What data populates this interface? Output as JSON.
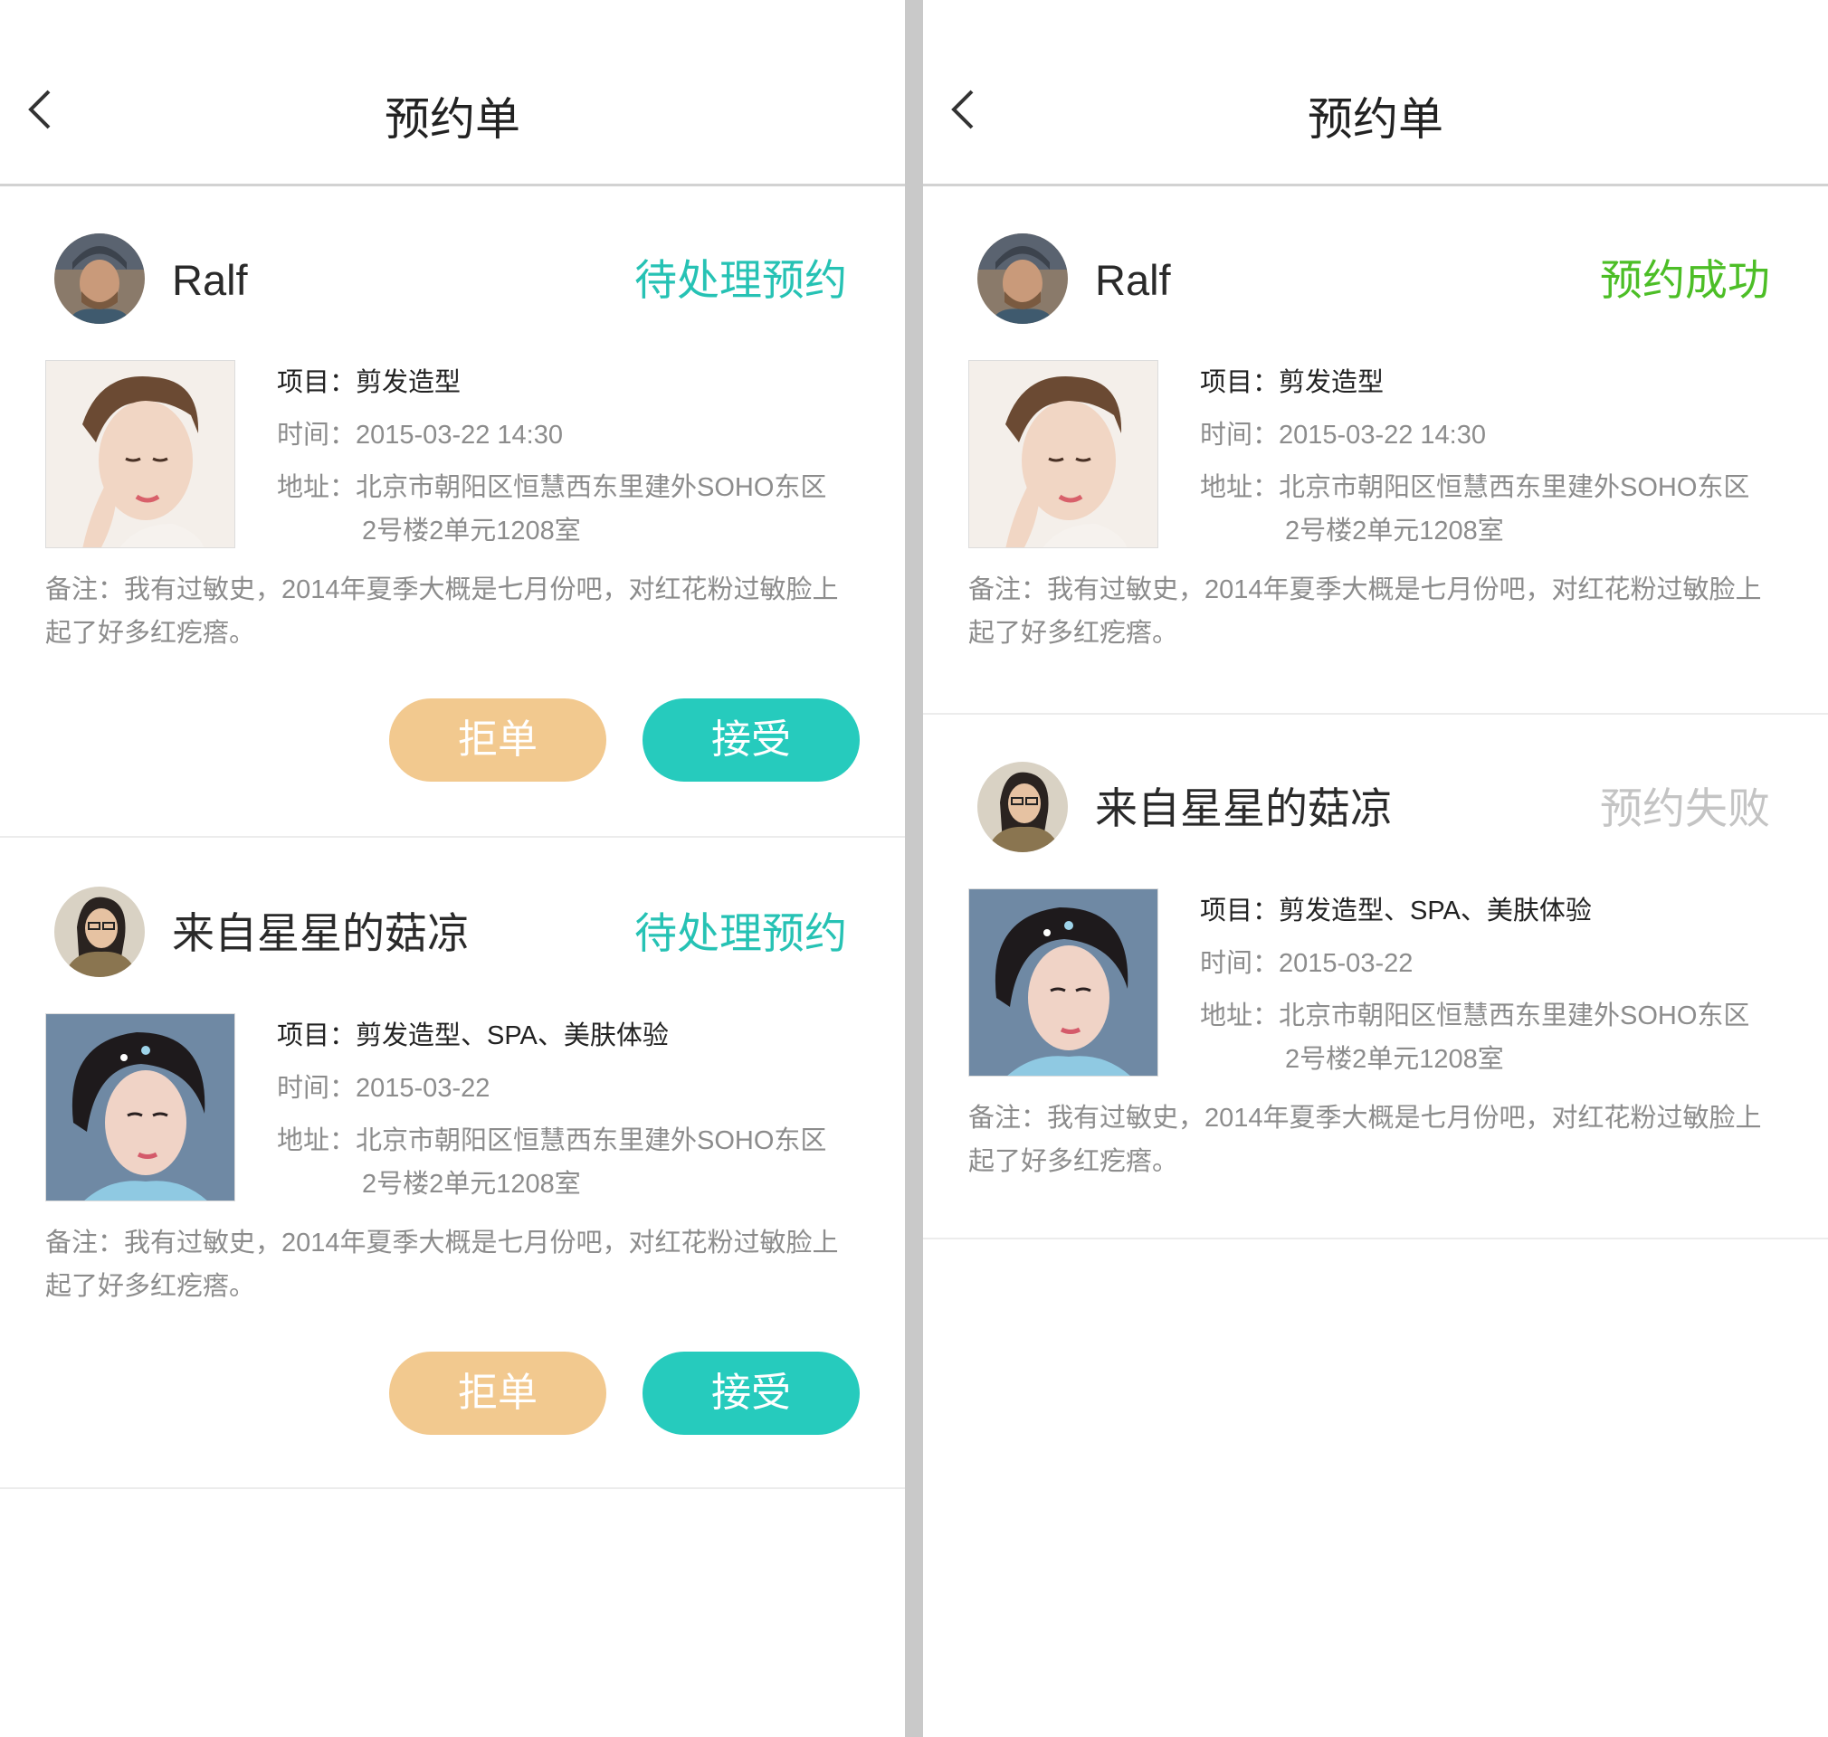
{
  "left": {
    "title": "预约单",
    "orders": [
      {
        "name": "Ralf",
        "status": "待处理预约",
        "project_label": "项目：",
        "project": "剪发造型",
        "time_label": "时间：",
        "time": "2015-03-22  14:30",
        "addr_label": "地址：",
        "address_line1": "北京市朝阳区恒慧西东里建外SOHO东区",
        "address_line2": "2号楼2单元1208室",
        "note_label": "备注：",
        "note": "我有过敏史，2014年夏季大概是七月份吧，对红花粉过敏脸上起了好多红疙瘩。",
        "reject_label": "拒单",
        "accept_label": "接受"
      },
      {
        "name": "来自星星的菇凉",
        "status": "待处理预约",
        "project_label": "项目：",
        "project": "剪发造型、SPA、美肤体验",
        "time_label": "时间：",
        "time": "2015-03-22",
        "addr_label": "地址：",
        "address_line1": "北京市朝阳区恒慧西东里建外SOHO东区",
        "address_line2": "2号楼2单元1208室",
        "note_label": "备注：",
        "note": "我有过敏史，2014年夏季大概是七月份吧，对红花粉过敏脸上起了好多红疙瘩。",
        "reject_label": "拒单",
        "accept_label": "接受"
      }
    ]
  },
  "right": {
    "title": "预约单",
    "orders": [
      {
        "name": "Ralf",
        "status": "预约成功",
        "project_label": "项目：",
        "project": "剪发造型",
        "time_label": "时间：",
        "time": "2015-03-22  14:30",
        "addr_label": "地址：",
        "address_line1": "北京市朝阳区恒慧西东里建外SOHO东区",
        "address_line2": "2号楼2单元1208室",
        "note_label": "备注：",
        "note": "我有过敏史，2014年夏季大概是七月份吧，对红花粉过敏脸上起了好多红疙瘩。"
      },
      {
        "name": "来自星星的菇凉",
        "status": "预约失败",
        "project_label": "项目：",
        "project": "剪发造型、SPA、美肤体验",
        "time_label": "时间：",
        "time": "2015-03-22",
        "addr_label": "地址：",
        "address_line1": "北京市朝阳区恒慧西东里建外SOHO东区",
        "address_line2": "2号楼2单元1208室",
        "note_label": "备注：",
        "note": "我有过敏史，2014年夏季大概是七月份吧，对红花粉过敏脸上起了好多红疙瘩。"
      }
    ]
  },
  "colors": {
    "pending": "#26c2b4",
    "success": "#4cbe26",
    "failed": "#c4c4c4",
    "reject_button": "#f2c98f",
    "accept_button": "#26cbbd",
    "divider": "#c9c9c9"
  },
  "icons": {
    "back": "chevron-left-icon"
  }
}
